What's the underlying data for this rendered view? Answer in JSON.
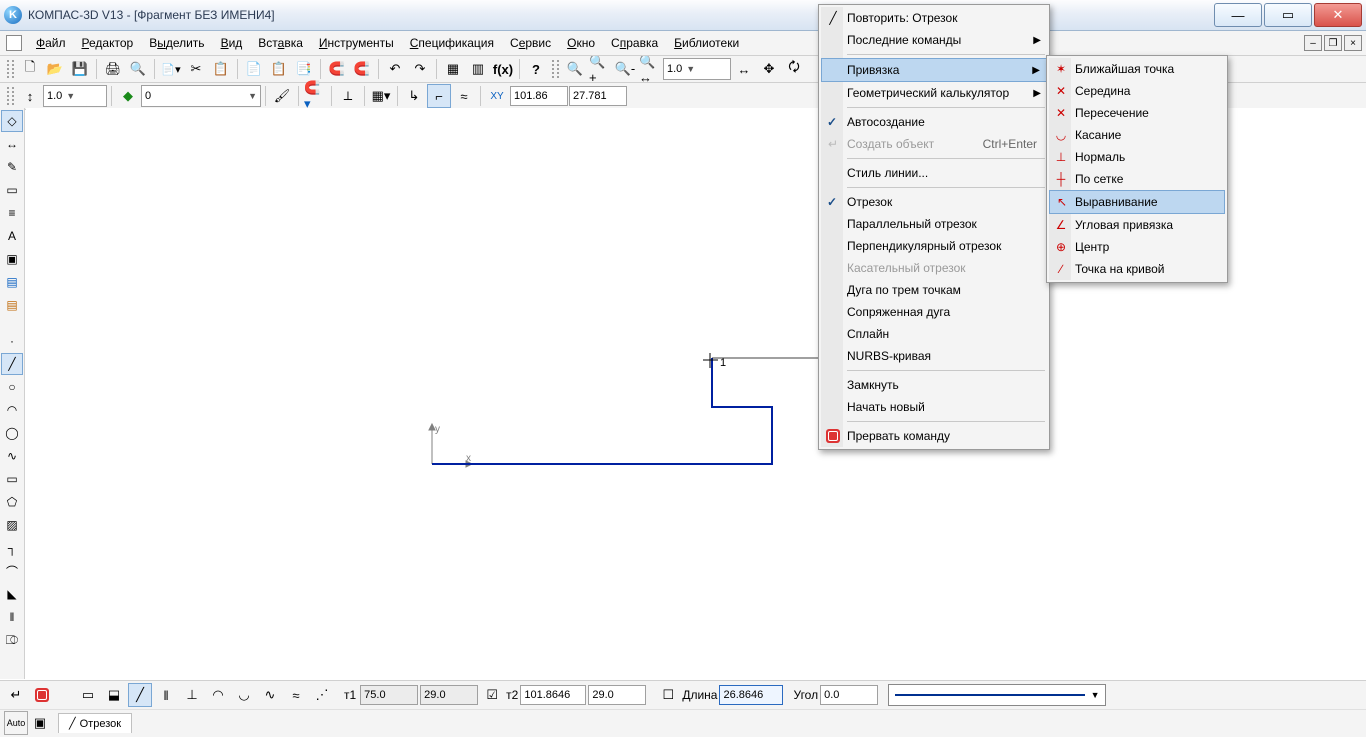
{
  "titlebar": {
    "app": "КОМПАС-3D V13",
    "doc": "[Фрагмент БЕЗ ИМЕНИ4]"
  },
  "menu": [
    "Файл",
    "Редактор",
    "Выделить",
    "Вид",
    "Вставка",
    "Инструменты",
    "Спецификация",
    "Сервис",
    "Окно",
    "Справка",
    "Библиотеки"
  ],
  "tb2": {
    "zoom": "1.0"
  },
  "tb3": {
    "scale": "1.0",
    "layer": "0",
    "coord_x": "101.86",
    "coord_y": "27.781"
  },
  "canvas": {
    "idx": "1"
  },
  "context1": {
    "repeat": "Повторить: Отрезок",
    "recent": "Последние команды",
    "snap": "Привязка",
    "calc": "Геометрический калькулятор",
    "auto": "Автосоздание",
    "create": "Создать объект",
    "create_kb": "Ctrl+Enter",
    "linestyle": "Стиль линии...",
    "seg": "Отрезок",
    "par": "Параллельный отрезок",
    "perp": "Перпендикулярный отрезок",
    "tang": "Касательный отрезок",
    "arc3": "Дуга по трем точкам",
    "arc_conj": "Сопряженная дуга",
    "spline": "Сплайн",
    "nurbs": "NURBS-кривая",
    "close": "Замкнуть",
    "new": "Начать новый",
    "stop": "Прервать команду"
  },
  "context2": {
    "nearest": "Ближайшая точка",
    "mid": "Середина",
    "inter": "Пересечение",
    "tan": "Касание",
    "norm": "Нормаль",
    "grid": "По сетке",
    "align": "Выравнивание",
    "angle": "Угловая привязка",
    "center": "Центр",
    "oncurve": "Точка на кривой"
  },
  "bottom": {
    "t1": "т1",
    "t1x": "75.0",
    "t1y": "29.0",
    "t2": "т2",
    "t2x": "101.8646",
    "t2y": "29.0",
    "len_lbl": "Длина",
    "len": "26.8646",
    "ang_lbl": "Угол",
    "ang": "0.0",
    "tab": "Отрезок"
  }
}
